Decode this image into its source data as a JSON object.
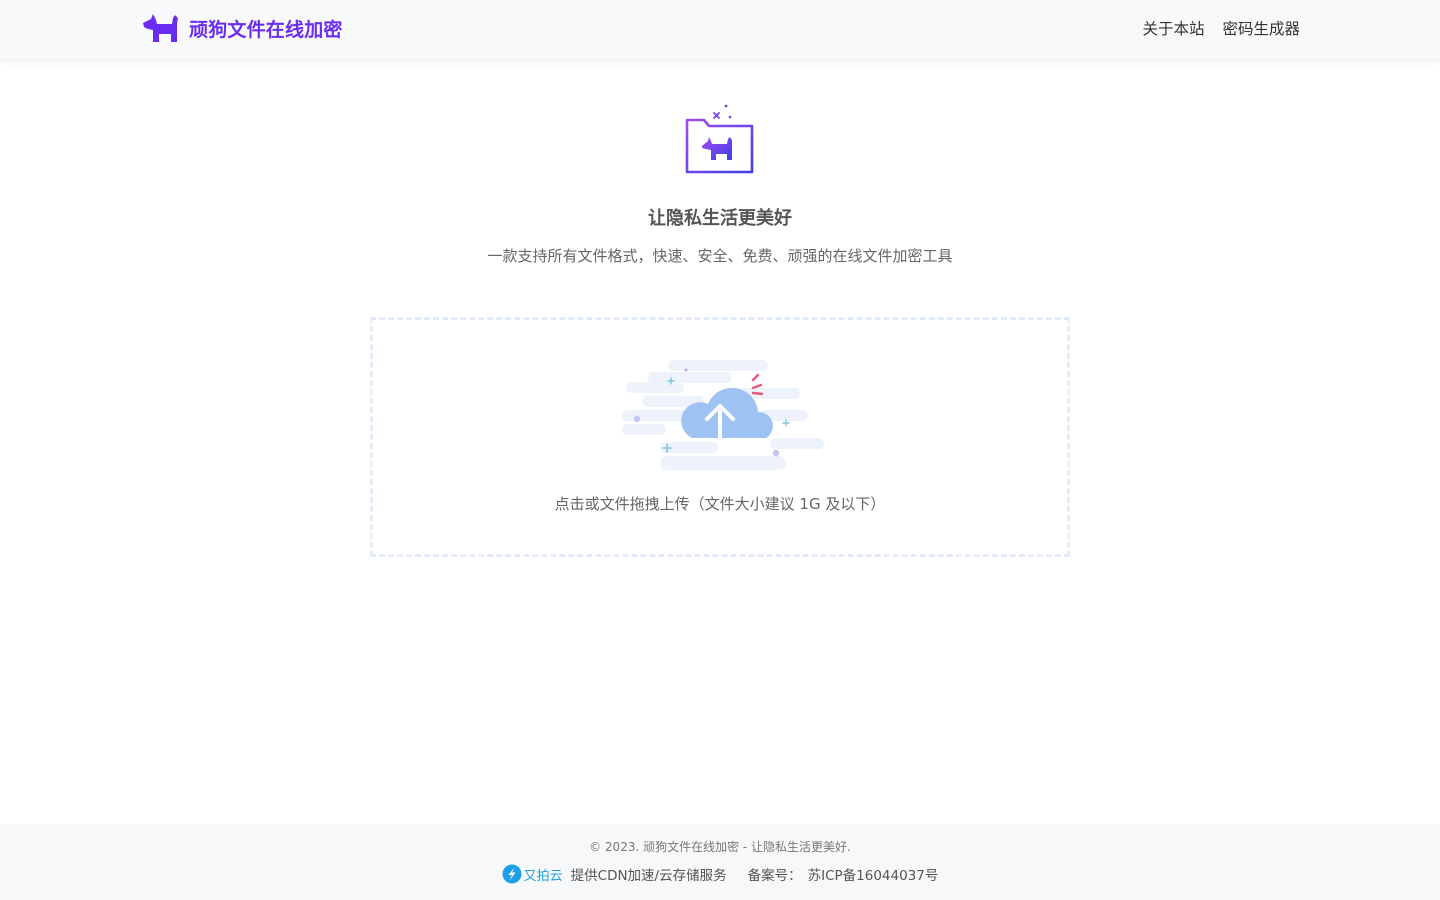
{
  "header": {
    "site_title": "顽狗文件在线加密",
    "nav": [
      {
        "label": "关于本站"
      },
      {
        "label": "密码生成器"
      }
    ]
  },
  "hero": {
    "title": "让隐私生活更美好",
    "subtitle": "一款支持所有文件格式，快速、安全、免费、顽强的在线文件加密工具"
  },
  "upload": {
    "hint": "点击或文件拖拽上传（文件大小建议 1G 及以下）"
  },
  "footer": {
    "copyright": "© 2023. 顽狗文件在线加密 - 让隐私生活更美好.",
    "sponsor_name": "又拍云",
    "sponsor_text": "提供CDN加速/云存储服务",
    "beian_label": "备案号：",
    "beian_number": "苏ICP备16044037号"
  },
  "colors": {
    "brand": "#6a2cf0",
    "dropzone_border": "#e3ebf6",
    "cloud": "#9ec2f2",
    "sponsor": "#1fa0e6"
  },
  "icons": {
    "brand_logo": "dog-icon",
    "hero": "folder-dog-icon",
    "upload": "cloud-upload-icon",
    "sponsor_logo": "upyun-logo-icon"
  }
}
